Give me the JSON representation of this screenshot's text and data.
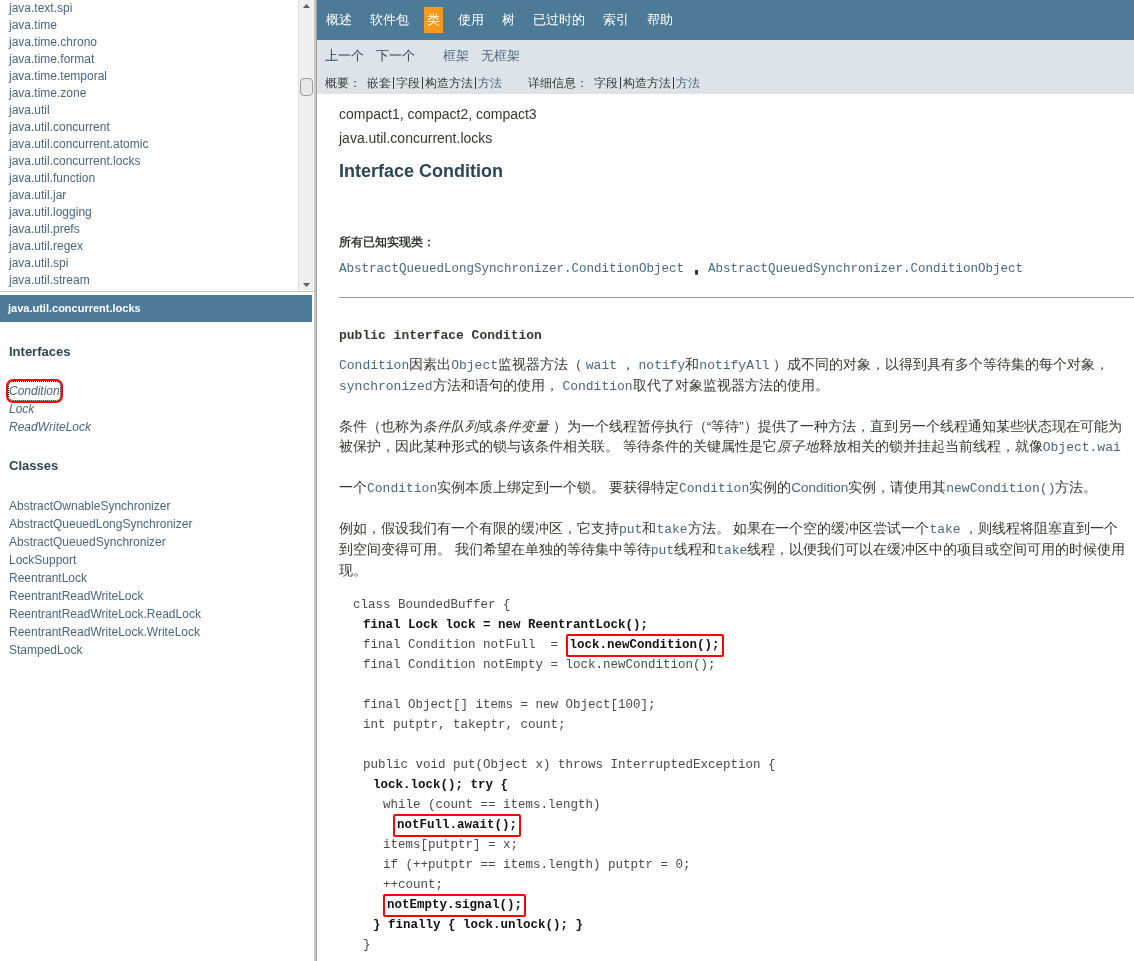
{
  "packages": {
    "items": [
      "java.text.spi",
      "java.time",
      "java.time.chrono",
      "java.time.format",
      "java.time.temporal",
      "java.time.zone",
      "java.util",
      "java.util.concurrent",
      "java.util.concurrent.atomic",
      "java.util.concurrent.locks",
      "java.util.function",
      "java.util.jar",
      "java.util.logging",
      "java.util.prefs",
      "java.util.regex",
      "java.util.spi",
      "java.util.stream"
    ]
  },
  "package_frame": {
    "title": "java.util.concurrent.locks",
    "interfaces_heading": "Interfaces",
    "interfaces": [
      {
        "label": "Condition",
        "selected": true,
        "highlighted": true
      },
      {
        "label": "Lock",
        "selected": false,
        "highlighted": false
      },
      {
        "label": "ReadWriteLock",
        "selected": false,
        "highlighted": false
      }
    ],
    "classes_heading": "Classes",
    "classes": [
      "AbstractOwnableSynchronizer",
      "AbstractQueuedLongSynchronizer",
      "AbstractQueuedSynchronizer",
      "LockSupport",
      "ReentrantLock",
      "ReentrantReadWriteLock",
      "ReentrantReadWriteLock.ReadLock",
      "ReentrantReadWriteLock.WriteLock",
      "StampedLock"
    ]
  },
  "nav": {
    "tabs": [
      {
        "label": "概述",
        "selected": false
      },
      {
        "label": "软件包",
        "selected": false
      },
      {
        "label": "类",
        "selected": true
      },
      {
        "label": "使用",
        "selected": false
      },
      {
        "label": "树",
        "selected": false
      },
      {
        "label": "已过时的",
        "selected": false
      },
      {
        "label": "索引",
        "selected": false
      },
      {
        "label": "帮助",
        "selected": false
      }
    ],
    "prev_next": [
      "上一个",
      "下一个"
    ],
    "frames": [
      "框架",
      "无框架"
    ],
    "summary": {
      "label": "概要：",
      "items": [
        {
          "text": "嵌套",
          "link": false
        },
        {
          "text": "字段",
          "link": false
        },
        {
          "text": "构造方法",
          "link": false
        },
        {
          "text": "方法",
          "link": true
        }
      ]
    },
    "detail": {
      "label": "详细信息：",
      "items": [
        {
          "text": "字段",
          "link": false
        },
        {
          "text": "构造方法",
          "link": false
        },
        {
          "text": "方法",
          "link": true
        }
      ]
    }
  },
  "content": {
    "profiles": "compact1, compact2, compact3",
    "package": "java.util.concurrent.locks",
    "title": "Interface Condition",
    "implementing_label": "所有已知实现类：",
    "implementing": [
      "AbstractQueuedLongSynchronizer.ConditionObject",
      "AbstractQueuedSynchronizer.ConditionObject"
    ],
    "declaration": "public interface Condition",
    "paragraphs": [
      [
        [
          {
            "kind": "code",
            "text": "Condition"
          },
          {
            "kind": "text",
            "text": "因素出"
          },
          {
            "kind": "code",
            "text": "Object"
          },
          {
            "kind": "text",
            "text": "监视器方法（ "
          },
          {
            "kind": "code_link",
            "text": "wait"
          },
          {
            "kind": "text",
            "text": " ， "
          },
          {
            "kind": "code_link",
            "text": "notify"
          },
          {
            "kind": "text",
            "text": "和"
          },
          {
            "kind": "code_link",
            "text": "notifyAll"
          },
          {
            "kind": "text",
            "text": " ）成不同的对象，以得到具有多个等待集的每个对象，"
          }
        ],
        [
          {
            "kind": "code",
            "text": "synchronized"
          },
          {
            "kind": "text",
            "text": "方法和语句的使用， "
          },
          {
            "kind": "code",
            "text": "Condition"
          },
          {
            "kind": "text",
            "text": "取代了对象监视器方法的使用。"
          }
        ]
      ],
      [
        [
          {
            "kind": "text",
            "text": "条件（也称为"
          },
          {
            "kind": "em",
            "text": "条件队列"
          },
          {
            "kind": "text",
            "text": "或"
          },
          {
            "kind": "em",
            "text": "条件变量"
          },
          {
            "kind": "text",
            "text": " ）为一个线程暂停执行（“等待”）提供了一种方法，直到另一个线程通知某些状态现在可能为"
          }
        ],
        [
          {
            "kind": "text",
            "text": "被保护，因此某种形式的锁与该条件相关联。 等待条件的关键属性是它"
          },
          {
            "kind": "em",
            "text": "原子地"
          },
          {
            "kind": "text",
            "text": "释放相关的锁并挂起当前线程，就像"
          },
          {
            "kind": "code",
            "text": "Object.wai"
          }
        ]
      ],
      [
        [
          {
            "kind": "text",
            "text": "一个"
          },
          {
            "kind": "code",
            "text": "Condition"
          },
          {
            "kind": "text",
            "text": "实例本质上绑定到一个锁。 要获得特定"
          },
          {
            "kind": "code",
            "text": "Condition"
          },
          {
            "kind": "text",
            "text": "实例的"
          },
          {
            "kind": "link",
            "text": "Condition"
          },
          {
            "kind": "text",
            "text": "实例，请使用其"
          },
          {
            "kind": "code_link",
            "text": "newCondition()"
          },
          {
            "kind": "text",
            "text": "方法。"
          }
        ]
      ],
      [
        [
          {
            "kind": "text",
            "text": "例如，假设我们有一个有限的缓冲区，它支持"
          },
          {
            "kind": "code",
            "text": "put"
          },
          {
            "kind": "text",
            "text": "和"
          },
          {
            "kind": "code",
            "text": "take"
          },
          {
            "kind": "text",
            "text": "方法。 如果在一个空的缓冲区尝试一个"
          },
          {
            "kind": "code",
            "text": "take"
          },
          {
            "kind": "text",
            "text": " ，则线程将阻塞直到一个"
          }
        ],
        [
          {
            "kind": "text",
            "text": "到空间变得可用。 我们希望在单独的等待集中等待"
          },
          {
            "kind": "code",
            "text": "put"
          },
          {
            "kind": "text",
            "text": "线程和"
          },
          {
            "kind": "code",
            "text": "take"
          },
          {
            "kind": "text",
            "text": "线程，以便我们可以在缓冲区中的项目或空间可用的时候使用"
          }
        ],
        [
          {
            "kind": "text",
            "text": "现。"
          }
        ]
      ]
    ],
    "code": [
      {
        "kind": "line",
        "parts": [
          {
            "text": "class BoundedBuffer {",
            "highlighted": false,
            "bold": false
          }
        ],
        "children": [
          {
            "kind": "line",
            "parts": [
              {
                "text": "final Lock lock = new ReentrantLock();",
                "highlighted": false,
                "bold": true
              }
            ]
          },
          {
            "kind": "line",
            "parts": [
              {
                "text": "final Condition notFull  = ",
                "highlighted": false,
                "bold": false
              },
              {
                "text": "lock.newCondition();",
                "highlighted": true,
                "bold": true
              }
            ]
          },
          {
            "kind": "line",
            "parts": [
              {
                "text": "final Condition notEmpty = lock.newCondition();",
                "highlighted": false,
                "bold": false
              }
            ]
          },
          {
            "kind": "blank"
          },
          {
            "kind": "line",
            "parts": [
              {
                "text": "final Object[] items = new Object[100];",
                "highlighted": false,
                "bold": false
              }
            ]
          },
          {
            "kind": "line",
            "parts": [
              {
                "text": "int putptr, takeptr, count;",
                "highlighted": false,
                "bold": false
              }
            ]
          },
          {
            "kind": "blank"
          },
          {
            "kind": "line",
            "parts": [
              {
                "text": "public void put(Object x) throws InterruptedException {",
                "highlighted": false,
                "bold": false
              }
            ],
            "children": [
              {
                "kind": "line",
                "parts": [
                  {
                    "text": "lock.lock(); try {",
                    "highlighted": false,
                    "bold": true
                  }
                ],
                "children": [
                  {
                    "kind": "line",
                    "parts": [
                      {
                        "text": "while (count == items.length)",
                        "highlighted": false,
                        "bold": false
                      }
                    ],
                    "children": [
                      {
                        "kind": "line",
                        "parts": [
                          {
                            "text": "notFull.await();",
                            "highlighted": true,
                            "bold": true
                          }
                        ]
                      }
                    ]
                  },
                  {
                    "kind": "line",
                    "parts": [
                      {
                        "text": "items[putptr] = x;",
                        "highlighted": false,
                        "bold": false
                      }
                    ]
                  },
                  {
                    "kind": "line",
                    "parts": [
                      {
                        "text": "if (++putptr == items.length) putptr = 0;",
                        "highlighted": false,
                        "bold": false
                      }
                    ]
                  },
                  {
                    "kind": "line",
                    "parts": [
                      {
                        "text": "++count;",
                        "highlighted": false,
                        "bold": false
                      }
                    ]
                  },
                  {
                    "kind": "line",
                    "parts": [
                      {
                        "text": "notEmpty.signal();",
                        "highlighted": true,
                        "bold": true
                      }
                    ]
                  }
                ]
              },
              {
                "kind": "line",
                "parts": [
                  {
                    "text": "} finally { lock.unlock(); }",
                    "highlighted": false,
                    "bold": true
                  }
                ]
              }
            ]
          },
          {
            "kind": "line",
            "parts": [
              {
                "text": "}",
                "highlighted": false,
                "bold": false
              }
            ]
          }
        ]
      }
    ]
  }
}
